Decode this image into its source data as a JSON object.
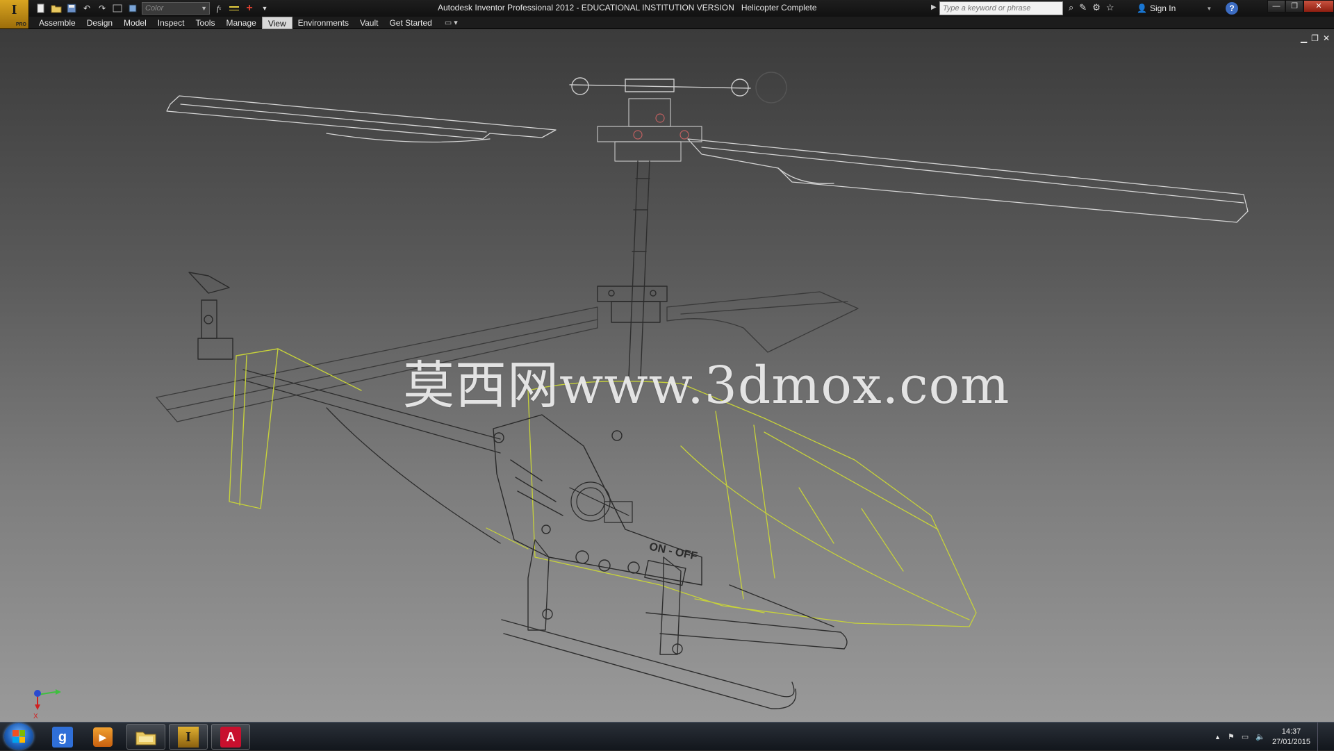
{
  "titlebar": {
    "app_letter": "I",
    "app_badge": "PRO",
    "color_select_value": "Color",
    "app_title": "Autodesk Inventor Professional 2012 - EDUCATIONAL INSTITUTION VERSION",
    "document_name": "Helicopter Complete",
    "search_placeholder": "Type a keyword or phrase",
    "sign_in_label": "Sign In",
    "help_label": "?"
  },
  "ribbon": {
    "tabs": [
      {
        "label": "Assemble"
      },
      {
        "label": "Design"
      },
      {
        "label": "Model"
      },
      {
        "label": "Inspect"
      },
      {
        "label": "Tools"
      },
      {
        "label": "Manage"
      },
      {
        "label": "View",
        "active": true
      },
      {
        "label": "Environments"
      },
      {
        "label": "Vault"
      },
      {
        "label": "Get Started"
      }
    ]
  },
  "viewport": {
    "watermark": "莫西网www.3dmox.com",
    "model_label": "ON - OFF",
    "triad_axis_label": "X"
  },
  "taskbar": {
    "pinned_apps": [
      {
        "name": "google-chrome",
        "icon": "g-icon",
        "glyph": "g"
      },
      {
        "name": "media-player",
        "icon": "play-icon",
        "glyph": "▶"
      },
      {
        "name": "file-explorer",
        "icon": "folder-icon",
        "glyph": ""
      },
      {
        "name": "autodesk-inventor",
        "icon": "inventor-icon",
        "glyph": "I"
      },
      {
        "name": "adobe-reader",
        "icon": "pdf-icon",
        "glyph": "A"
      }
    ],
    "clock_time": "14:37",
    "clock_date": "27/01/2015"
  },
  "colors": {
    "wire_gray": "#d0d0d0",
    "wire_dark": "#3a3a3a",
    "wire_yellow": "#c7d23a",
    "accent_blue": "#3c6cc2"
  }
}
